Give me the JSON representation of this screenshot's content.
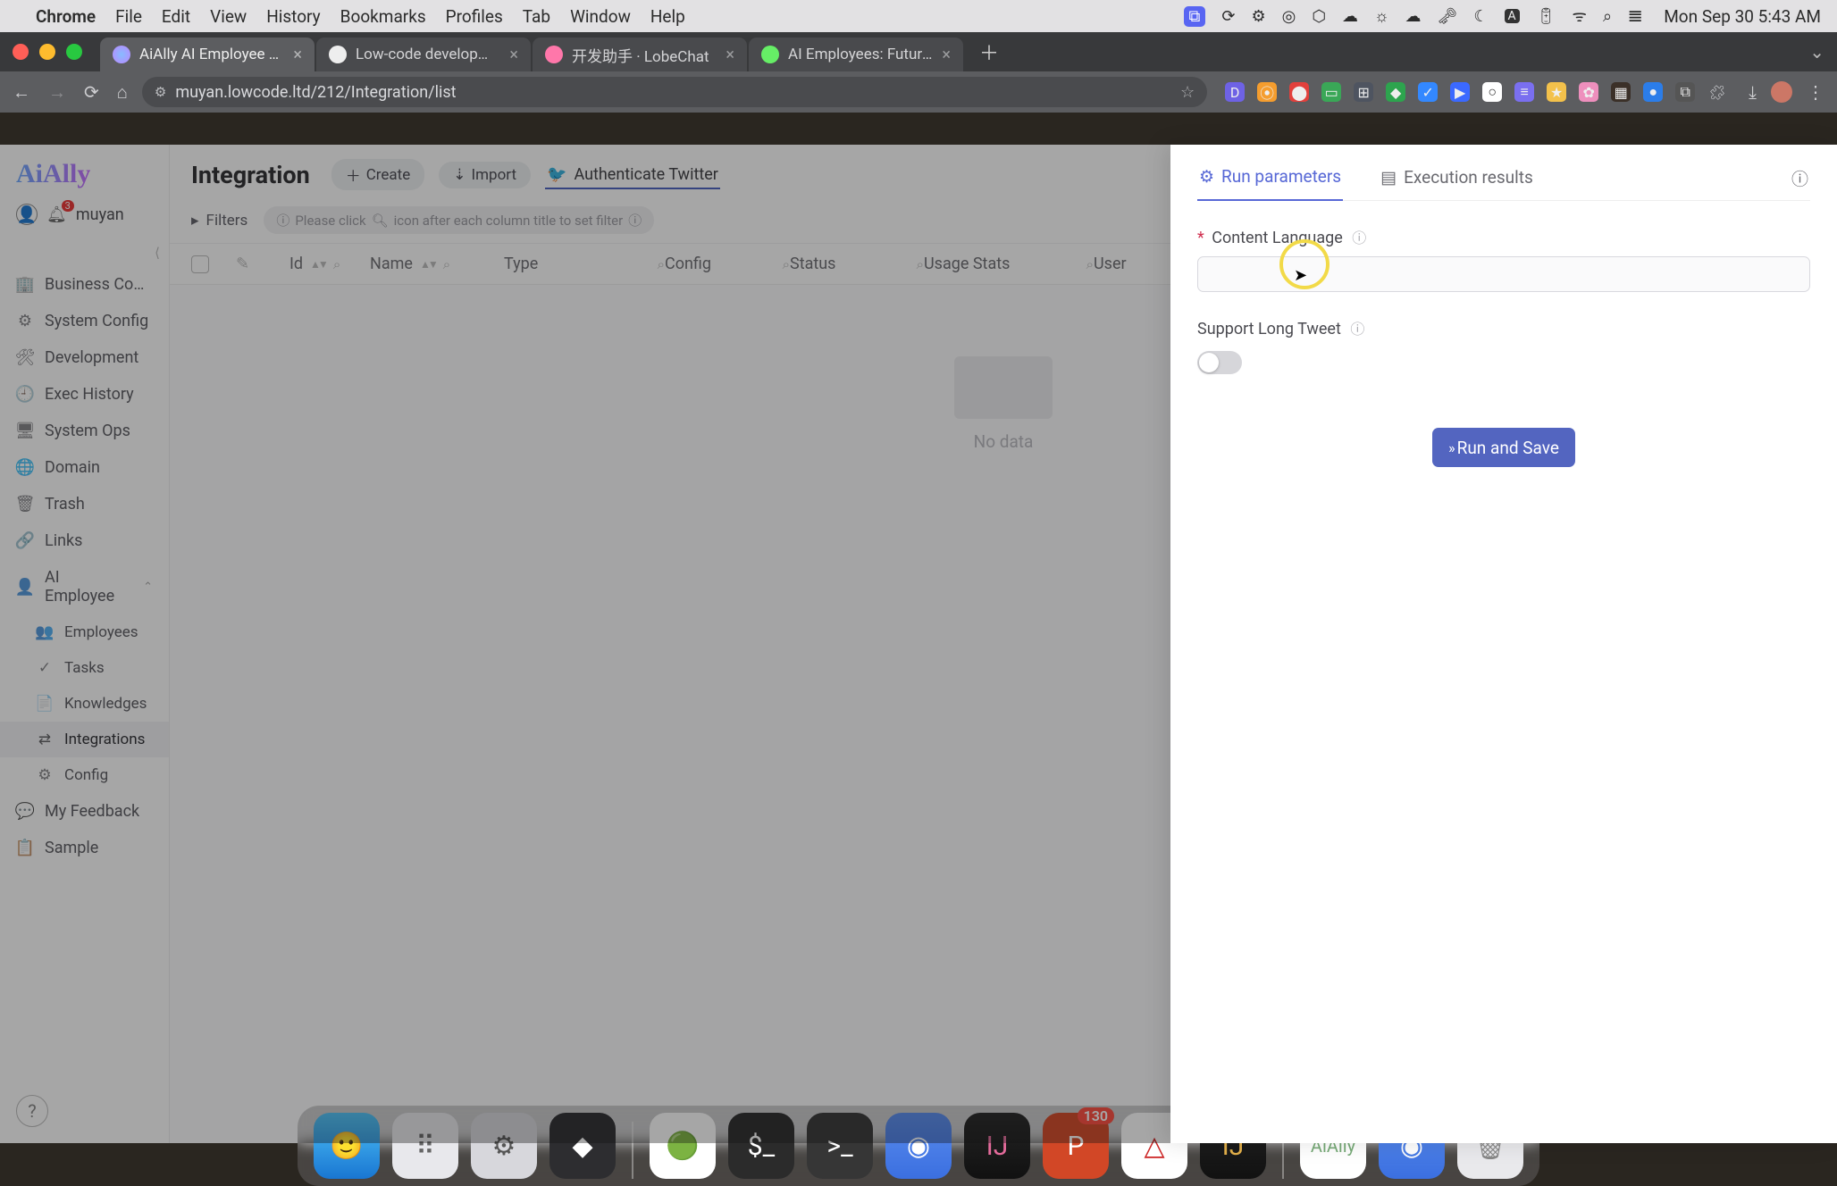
{
  "mac_menu": {
    "app": "Chrome",
    "items": [
      "File",
      "Edit",
      "View",
      "History",
      "Bookmarks",
      "Profiles",
      "Tab",
      "Window",
      "Help"
    ],
    "clock": "Mon Sep 30  5:43 AM"
  },
  "browser": {
    "tabs": [
      {
        "label": "AiAlly AI Employee System",
        "active": true
      },
      {
        "label": "Low-code development com…",
        "active": false
      },
      {
        "label": "开发助手 · LobeChat",
        "active": false
      },
      {
        "label": "AI Employees: Future of Work",
        "active": false
      }
    ],
    "url": "muyan.lowcode.ltd/212/Integration/list"
  },
  "sidebar": {
    "brand": "AiAlly",
    "username": "muyan",
    "badge": "3",
    "groups": [
      {
        "icon": "🏢",
        "label": "Business Co…",
        "indent": 0
      },
      {
        "icon": "⚙",
        "label": "System Config",
        "indent": 0
      },
      {
        "icon": "🛠",
        "label": "Development",
        "indent": 0
      },
      {
        "icon": "🕘",
        "label": "Exec History",
        "indent": 0
      },
      {
        "icon": "🖥",
        "label": "System Ops",
        "indent": 0
      },
      {
        "icon": "🌐",
        "label": "Domain",
        "indent": 0
      },
      {
        "icon": "🗑",
        "label": "Trash",
        "indent": 0
      },
      {
        "icon": "🔗",
        "label": "Links",
        "indent": 0
      },
      {
        "icon": "👤",
        "label": "AI Employee",
        "indent": 0,
        "expandable": true
      },
      {
        "icon": "👥",
        "label": "Employees",
        "indent": 1
      },
      {
        "icon": "✓",
        "label": "Tasks",
        "indent": 1
      },
      {
        "icon": "📄",
        "label": "Knowledges",
        "indent": 1
      },
      {
        "icon": "⇄",
        "label": "Integrations",
        "indent": 1,
        "active": true
      },
      {
        "icon": "⚙",
        "label": "Config",
        "indent": 1
      },
      {
        "icon": "💬",
        "label": "My Feedback",
        "indent": 0
      },
      {
        "icon": "📋",
        "label": "Sample",
        "indent": 0
      }
    ]
  },
  "main": {
    "title": "Integration",
    "create": "Create",
    "import": "Import",
    "auth": "Authenticate Twitter",
    "filters": "Filters",
    "hint_pre": "Please click",
    "hint_post": "icon after each column title to set filter",
    "columns": [
      "Id",
      "Name",
      "Type",
      "Config",
      "Status",
      "Usage Stats",
      "User"
    ],
    "nodata": "No data"
  },
  "drawer": {
    "tab_params": "Run parameters",
    "tab_results": "Execution results",
    "field1": "Content Language",
    "field2": "Support Long Tweet",
    "run": "Run and Save"
  }
}
